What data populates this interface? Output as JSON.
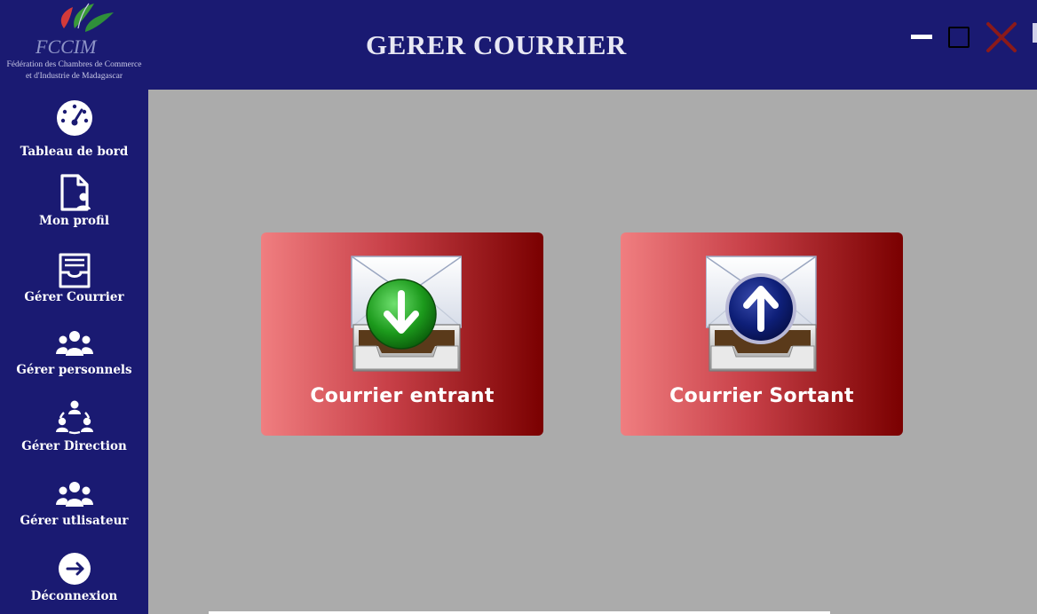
{
  "header": {
    "title": "GERER COURRIER",
    "logo_line1": "Fédération des Chambres de Commerce",
    "logo_line2": "et d'Industrie de Madagascar"
  },
  "sidebar": {
    "items": [
      {
        "label": "Tableau de bord",
        "icon": "dashboard-icon"
      },
      {
        "label": "Mon profil",
        "icon": "profile-file-icon"
      },
      {
        "label": "Gérer Courrier",
        "icon": "inbox-tray-icon"
      },
      {
        "label": "Gérer personnels",
        "icon": "users-group-icon"
      },
      {
        "label": "Gérer Direction",
        "icon": "team-network-icon"
      },
      {
        "label": "Gérer utlisateur",
        "icon": "users-group-icon"
      },
      {
        "label": "Déconnexion",
        "icon": "logout-icon"
      }
    ]
  },
  "cards": [
    {
      "label": "Courrier entrant",
      "icon": "mail-inbox-download-icon"
    },
    {
      "label": "Courrier Sortant",
      "icon": "mail-outbox-upload-icon"
    }
  ],
  "colors": {
    "sidebar_bg": "#1a1a72",
    "main_bg": "#ababab",
    "card_gradient_start": "#f07e80",
    "card_gradient_end": "#7a0000",
    "close_icon": "#8b1a1a"
  }
}
